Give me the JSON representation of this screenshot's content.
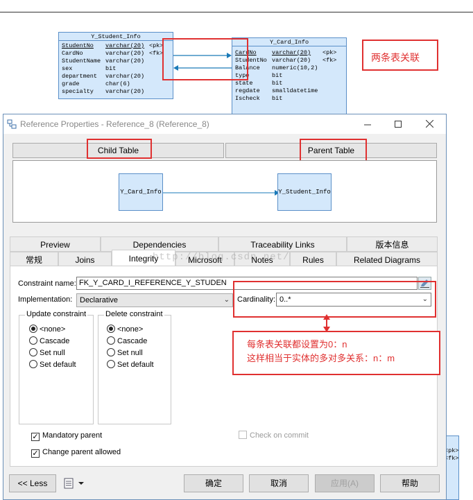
{
  "diagram": {
    "student_table": {
      "title": "Y_Student_Info",
      "rows": [
        {
          "name": "StudentNo",
          "type": "varchar(20)",
          "key": "<pk>"
        },
        {
          "name": "CardNo",
          "type": "varchar(20)",
          "key": "<fk>"
        },
        {
          "name": "StudentName",
          "type": "varchar(20)",
          "key": ""
        },
        {
          "name": "sex",
          "type": "bit",
          "key": ""
        },
        {
          "name": "department",
          "type": "varchar(20)",
          "key": ""
        },
        {
          "name": "grade",
          "type": "char(6)",
          "key": ""
        },
        {
          "name": "specialty",
          "type": "varchar(20)",
          "key": ""
        }
      ]
    },
    "card_table": {
      "title": "Y_Card_Info",
      "rows": [
        {
          "name": "CardNo",
          "type": "varchar(20)",
          "key": "<pk>"
        },
        {
          "name": "StudentNo",
          "type": "varchar(20)",
          "key": "<fk>"
        },
        {
          "name": "Balance",
          "type": "numeric(10,2)",
          "key": ""
        },
        {
          "name": "type",
          "type": "bit",
          "key": ""
        },
        {
          "name": "state",
          "type": "bit",
          "key": ""
        },
        {
          "name": "regdate",
          "type": "smalldatetime",
          "key": ""
        },
        {
          "name": "Ischeck",
          "type": "bit",
          "key": ""
        }
      ]
    },
    "annotation_top": "两条表关联",
    "bottom_right_fragment": [
      "<pk>",
      "<fk>"
    ]
  },
  "dialog": {
    "title": "Reference Properties - Reference_8 (Reference_8)",
    "child_table_label": "Child Table",
    "parent_table_label": "Parent Table",
    "preview_child": "Y_Card_Info",
    "preview_parent": "Y_Student_Info",
    "tabs_row1": [
      "Preview",
      "Dependencies",
      "Traceability Links",
      "版本信息"
    ],
    "tabs_row2": [
      "常规",
      "Joins",
      "Integrity",
      "Microsoft",
      "Notes",
      "Rules",
      "Related Diagrams"
    ],
    "constraint_name_label": "Constraint name:",
    "constraint_name_value": "FK_Y_CARD_I_REFERENCE_Y_STUDEN",
    "implementation_label": "Implementation:",
    "implementation_value": "Declarative",
    "cardinality_label": "Cardinality:",
    "cardinality_value": "0..*",
    "update_constraint": {
      "title": "Update constraint",
      "options": [
        "<none>",
        "Cascade",
        "Set null",
        "Set default"
      ]
    },
    "delete_constraint": {
      "title": "Delete constraint",
      "options": [
        "<none>",
        "Cascade",
        "Set null",
        "Set default"
      ]
    },
    "mandatory_parent": "Mandatory parent",
    "change_parent_allowed": "Change parent allowed",
    "check_on_commit": "Check on commit",
    "check_mark": "✓",
    "buttons": {
      "less": "<< Less",
      "ok": "确定",
      "cancel": "取消",
      "apply": "应用(A)",
      "help": "帮助"
    }
  },
  "annotation_note": {
    "line1": "每条表关联都设置为0：n",
    "line2": "这样相当于实体的多对多关系：n：m"
  },
  "watermark": "http://blog.csdn.net/",
  "colors": {
    "annotation_red": "#e03030",
    "table_fill": "#d4e8fb",
    "table_border": "#5a8fc8",
    "link_line": "#1a7ab8"
  }
}
